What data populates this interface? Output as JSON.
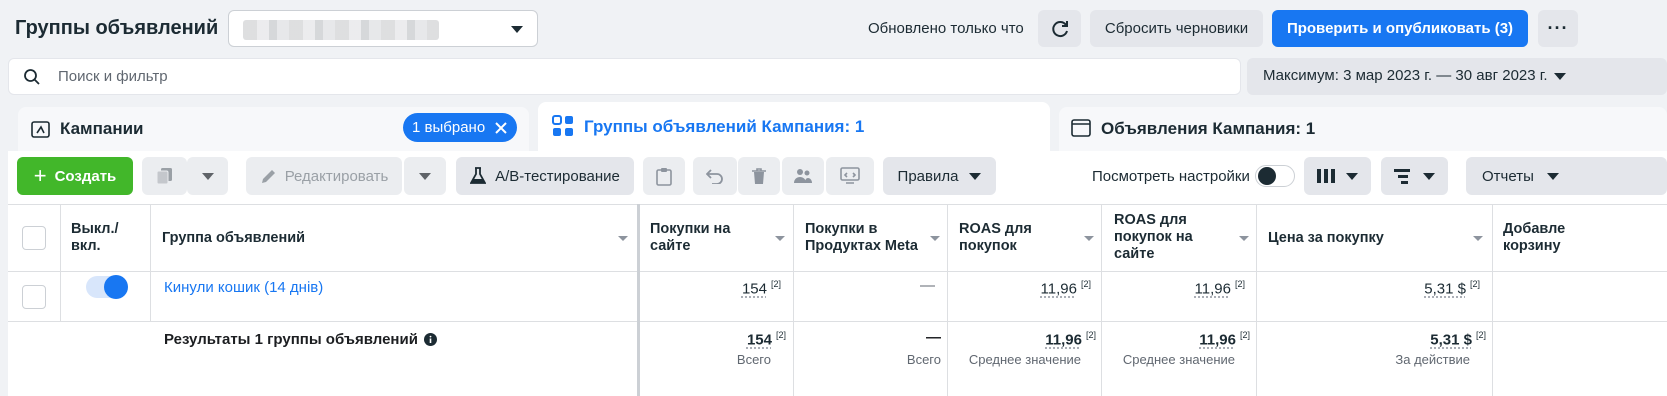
{
  "header": {
    "title": "Группы объявлений",
    "updated_text": "Обновлено только что",
    "reset_label": "Сбросить черновики",
    "publish_label": "Проверить и опубликовать (3)",
    "more_label": "···"
  },
  "search": {
    "placeholder": "Поиск и фильтр"
  },
  "date_range": {
    "label": "Максимум: 3 мар 2023 г. — 30 авг 2023 г."
  },
  "tabs": {
    "campaigns": {
      "label": "Кампании",
      "selected_badge": "1 выбрано"
    },
    "adsets": {
      "label": "Группы объявлений Кампания: 1"
    },
    "ads": {
      "label": "Объявления Кампания: 1"
    }
  },
  "toolbar": {
    "create_label": "Создать",
    "edit_label": "Редактировать",
    "ab_test_label": "A/B-тестирование",
    "rules_label": "Правила",
    "view_settings_label": "Посмотреть настройки",
    "reports_label": "Отчеты"
  },
  "table": {
    "columns": {
      "toggle": "Выкл./ вкл.",
      "name": "Группа объявлений",
      "site_purchases": "Покупки на сайте",
      "meta_purchases": "Покупки в Продуктах Meta",
      "roas_purchases": "ROAS для покупок",
      "roas_site": "ROAS для покупок на сайте",
      "cost_per_purchase": "Цена за покупку",
      "add_to_cart": "Добавле корзину"
    },
    "row": {
      "name": "Кинули кошик (14 днів)",
      "site_purchases": "154",
      "meta_purchases": "—",
      "roas_purchases": "11,96",
      "roas_site": "11,96",
      "cost_per_purchase": "5,31 $",
      "footnote": "[2]",
      "toggle_on": true
    },
    "summary": {
      "label": "Результаты 1 группы объявлений",
      "site_purchases": "154",
      "site_purchases_sub": "Всего",
      "meta_purchases": "—",
      "meta_purchases_sub": "Всего",
      "roas_purchases": "11,96",
      "roas_purchases_sub": "Среднее значение",
      "roas_site": "11,96",
      "roas_site_sub": "Среднее значение",
      "cost_per_purchase": "5,31 $",
      "cost_per_purchase_sub": "За действие",
      "footnote": "[2]"
    }
  },
  "colors": {
    "primary": "#1877f2",
    "create": "#42b72a",
    "text": "#1c2b33"
  }
}
